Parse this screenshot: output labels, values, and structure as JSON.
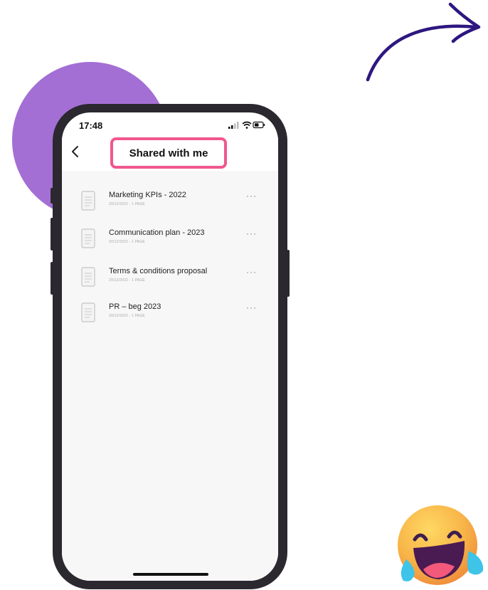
{
  "status_bar": {
    "time": "17:48",
    "icons": [
      "signal-icon",
      "wifi-icon",
      "battery-icon"
    ]
  },
  "header": {
    "back_icon": "chevron-left-icon",
    "title": "Shared with me"
  },
  "documents": [
    {
      "title": "Marketing KPIs - 2022",
      "meta": "20/12/2022 - 1 PAGE"
    },
    {
      "title": "Communication plan - 2023",
      "meta": "20/12/2022 - 1 PAGE"
    },
    {
      "title": "Terms & conditions proposal",
      "meta": "20/12/2022 - 1 PAGE"
    },
    {
      "title": "PR – beg 2023",
      "meta": "20/12/2022 - 1 PAGE"
    }
  ],
  "more_label": "···",
  "colors": {
    "highlight": "#f0578e",
    "purple_blob": "#a46fd4",
    "arrow": "#2e1780",
    "phone_frame": "#2b2830"
  },
  "decorations": [
    "curved-arrow-icon",
    "laughing-emoji-icon"
  ]
}
